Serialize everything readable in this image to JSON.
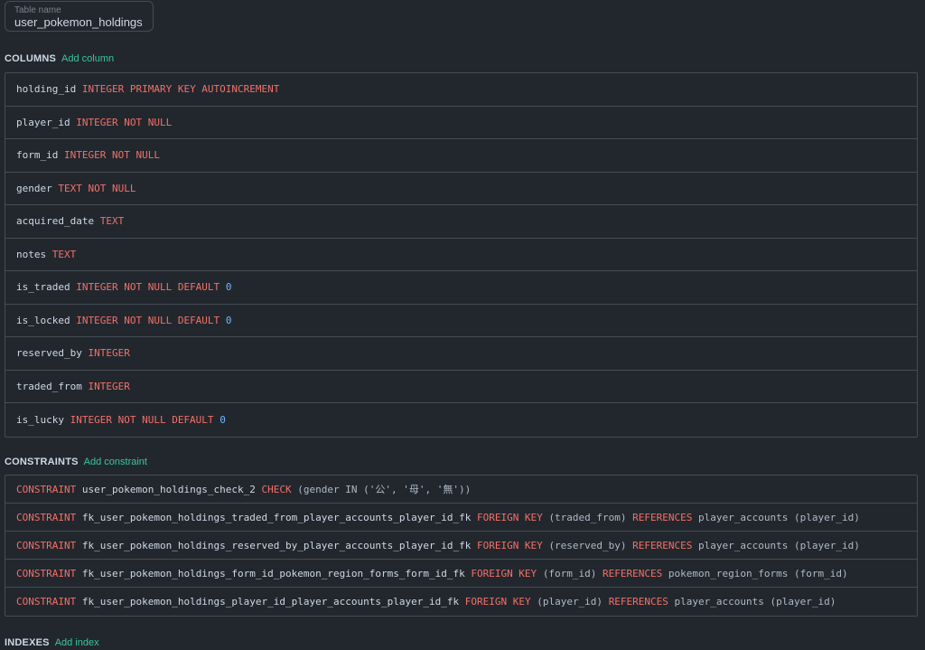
{
  "table_name": {
    "label": "Table name",
    "value": "user_pokemon_holdings"
  },
  "columns_section": {
    "title": "COLUMNS",
    "add_label": "Add column"
  },
  "columns": [
    {
      "name": "holding_id",
      "def": "INTEGER PRIMARY KEY AUTOINCREMENT",
      "default": ""
    },
    {
      "name": "player_id",
      "def": "INTEGER NOT NULL",
      "default": ""
    },
    {
      "name": "form_id",
      "def": "INTEGER NOT NULL",
      "default": ""
    },
    {
      "name": "gender",
      "def": "TEXT NOT NULL",
      "default": ""
    },
    {
      "name": "acquired_date",
      "def": "TEXT",
      "default": ""
    },
    {
      "name": "notes",
      "def": "TEXT",
      "default": ""
    },
    {
      "name": "is_traded",
      "def": "INTEGER NOT NULL DEFAULT",
      "default": "0"
    },
    {
      "name": "is_locked",
      "def": "INTEGER NOT NULL DEFAULT",
      "default": "0"
    },
    {
      "name": "reserved_by",
      "def": "INTEGER",
      "default": ""
    },
    {
      "name": "traded_from",
      "def": "INTEGER",
      "default": ""
    },
    {
      "name": "is_lucky",
      "def": "INTEGER NOT NULL DEFAULT",
      "default": "0"
    }
  ],
  "constraints_section": {
    "title": "CONSTRAINTS",
    "add_label": "Add constraint"
  },
  "constraints": [
    {
      "kw1": "CONSTRAINT",
      "name": "user_pokemon_holdings_check_2",
      "kw2": "CHECK",
      "body": "(gender IN ('公', '母', '無'))",
      "kw3": "",
      "ref_table": "",
      "ref_cols": ""
    },
    {
      "kw1": "CONSTRAINT",
      "name": "fk_user_pokemon_holdings_traded_from_player_accounts_player_id_fk",
      "kw2": "FOREIGN KEY",
      "body": "(traded_from)",
      "kw3": "REFERENCES",
      "ref_table": "player_accounts",
      "ref_cols": "(player_id)"
    },
    {
      "kw1": "CONSTRAINT",
      "name": "fk_user_pokemon_holdings_reserved_by_player_accounts_player_id_fk",
      "kw2": "FOREIGN KEY",
      "body": "(reserved_by)",
      "kw3": "REFERENCES",
      "ref_table": "player_accounts",
      "ref_cols": "(player_id)"
    },
    {
      "kw1": "CONSTRAINT",
      "name": "fk_user_pokemon_holdings_form_id_pokemon_region_forms_form_id_fk",
      "kw2": "FOREIGN KEY",
      "body": "(form_id)",
      "kw3": "REFERENCES",
      "ref_table": "pokemon_region_forms",
      "ref_cols": "(form_id)"
    },
    {
      "kw1": "CONSTRAINT",
      "name": "fk_user_pokemon_holdings_player_id_player_accounts_player_id_fk",
      "kw2": "FOREIGN KEY",
      "body": "(player_id)",
      "kw3": "REFERENCES",
      "ref_table": "player_accounts",
      "ref_cols": "(player_id)"
    }
  ],
  "indexes_section": {
    "title": "INDEXES",
    "add_label": "Add index"
  },
  "colors": {
    "background": "#22272e",
    "border": "#444c56",
    "keyword": "#f47067",
    "number": "#6cb6ff",
    "accent_link": "#39c5a0"
  }
}
